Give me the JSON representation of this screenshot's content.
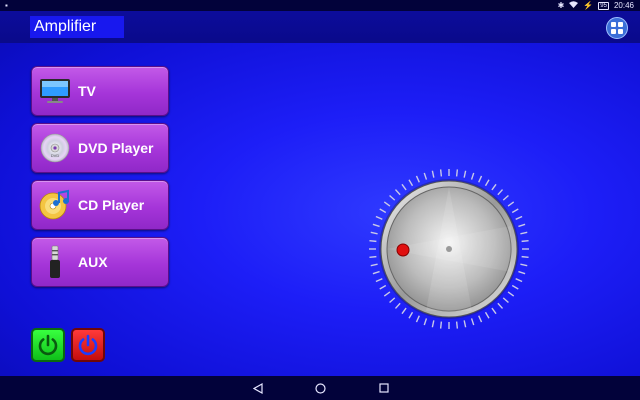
{
  "status_bar": {
    "time": "20:46",
    "battery_level": "95",
    "icons": [
      "notification-icon",
      "bluetooth-icon",
      "wifi-icon",
      "battery-icon"
    ]
  },
  "header": {
    "title": "Amplifier",
    "menu_icon": "grid-menu-icon"
  },
  "sources": [
    {
      "label": "TV",
      "icon": "tv-icon"
    },
    {
      "label": "DVD Player",
      "icon": "dvd-icon"
    },
    {
      "label": "CD Player",
      "icon": "cd-music-icon"
    },
    {
      "label": "AUX",
      "icon": "audio-jack-icon"
    }
  ],
  "power": {
    "on_icon": "power-on-icon",
    "off_icon": "power-off-icon",
    "on_color": "#1fd826",
    "off_color": "#e01414"
  },
  "volume_knob": {
    "indicator_color": "#e01010"
  },
  "colors": {
    "background": "#1d1ef7",
    "header": "#0a0a8a",
    "button": "#a535d9",
    "title_box": "#1818ee"
  },
  "nav_bar": {
    "icons": [
      "back-icon",
      "home-icon",
      "recents-icon"
    ]
  }
}
